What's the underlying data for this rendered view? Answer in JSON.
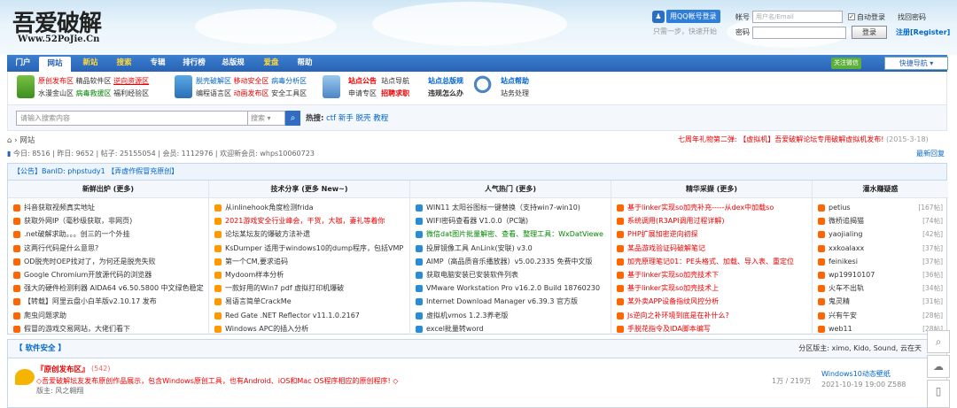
{
  "logo": {
    "title": "吾爱破解",
    "url": "Www.52PoJie.Cn"
  },
  "login": {
    "qq_button": "用QQ帐号登录",
    "qq_tip": "只需一步，快速开始",
    "account_label": "帐号",
    "account_placeholder": "用户名/Email",
    "auto_login": "自动登录",
    "find_password": "找回密码",
    "password_label": "密码",
    "login_button": "登录",
    "register": "注册[Register]"
  },
  "nav": {
    "items": [
      "门户",
      "网站",
      "新站",
      "搜索",
      "专辑",
      "排行榜",
      "总版规",
      "爱盘",
      "帮助"
    ],
    "wechat": "关注微信",
    "quick_nav": "快捷导航"
  },
  "subnav": {
    "g1": {
      "line1": [
        "原创发布区",
        "精品软件区",
        "逆向资源区"
      ],
      "line2": [
        "水漫金山区",
        "病毒救援区",
        "福利经验区"
      ]
    },
    "g2": {
      "line1": [
        "脱壳破解区",
        "移动安全区",
        "病毒分析区"
      ],
      "line2": [
        "编程语言区",
        "动画发布区",
        "安全工具区"
      ]
    },
    "g3": {
      "line1": [
        "站点公告",
        "站点导航"
      ],
      "line2": [
        "申请专区",
        "招聘求职"
      ]
    },
    "g4": {
      "line1": [
        "站点总版规",
        "站点帮助"
      ],
      "line2": [
        "违规怎么办",
        "站务处理"
      ]
    }
  },
  "search": {
    "placeholder": "请输入搜索内容",
    "type": "搜索",
    "hot_label": "热搜:",
    "hot": [
      "ctf",
      "新手",
      "脱壳",
      "教程"
    ]
  },
  "breadcrumb": "网站",
  "promo": {
    "prefix": "七周年礼物第二弹:",
    "link": "【虚拟机】吾爱破解论坛专用破解虚拟机发布!",
    "date": "(2015-3-18)"
  },
  "stats": "今日: 8516 | 昨日: 9652 | 帖子: 25155054 | 会员: 1112976 | 欢迎新会员: whps10060723",
  "latest_reply": "最新回复",
  "announce": "【公告】BanID: phpstudy1 【弄虚作假冒充原创】",
  "columns": [
    {
      "title": "新鲜出炉 (更多)",
      "items": [
        {
          "t": "抖音获取视频真实地址",
          "c": "#f60",
          "tc": "#333"
        },
        {
          "t": "获取外网IP（毫秒级获取，非网页)",
          "c": "#f60",
          "tc": "#333"
        },
        {
          "t": ".net破解求助。。。创三的一个外挂",
          "c": "#f60",
          "tc": "#333"
        },
        {
          "t": "这两行代码是什么意思?",
          "c": "#f60",
          "tc": "#333"
        },
        {
          "t": "OD脱壳时OEP找对了，为何还是脱壳失败",
          "c": "#f60",
          "tc": "#333"
        },
        {
          "t": "Google Chromium开放源代码的浏览器",
          "c": "#f60",
          "tc": "#333"
        },
        {
          "t": "强大的硬件检测利器 AIDA64 v6.50.5800 中文绿色稳定",
          "c": "#f60",
          "tc": "#333"
        },
        {
          "t": "【转载】阿里云盘小白羊版v2.10.17 发布",
          "c": "#f60",
          "tc": "#333"
        },
        {
          "t": "爬虫问题求助",
          "c": "#f60",
          "tc": "#333"
        },
        {
          "t": "假冒的游戏交易网站，大佬们看下",
          "c": "#f60",
          "tc": "#333"
        }
      ]
    },
    {
      "title": "技术分享 (更多 New~)",
      "items": [
        {
          "t": "从inlinehook角度检测frida",
          "c": "#f90",
          "tc": "#333"
        },
        {
          "t": "2021游戏安全行业峰会，干货，大咖，妻礼等着你",
          "c": "#f90",
          "tc": "#e00"
        },
        {
          "t": "论坛某坛友的爆破方法补遗",
          "c": "#f90",
          "tc": "#333"
        },
        {
          "t": "KsDumper 适用于windows10的dump程序，包括VMP",
          "c": "#f90",
          "tc": "#333"
        },
        {
          "t": "第一个CM,要求追码",
          "c": "#f90",
          "tc": "#333"
        },
        {
          "t": "Mydoom样本分析",
          "c": "#f90",
          "tc": "#333"
        },
        {
          "t": "一款好用的Win7 pdf 虚拟打印机爆破",
          "c": "#f90",
          "tc": "#333"
        },
        {
          "t": "易语言简单CrackMe",
          "c": "#f90",
          "tc": "#333"
        },
        {
          "t": "Red Gate .NET Reflector v11.1.0.2167",
          "c": "#f90",
          "tc": "#333"
        },
        {
          "t": "Windows APC的插入分析",
          "c": "#f90",
          "tc": "#333"
        }
      ]
    },
    {
      "title": "人气热门 (更多)",
      "items": [
        {
          "t": "WIN11 太阳谷图标一键替换（支持win7-win10)",
          "c": "#2a8bd8",
          "tc": "#333"
        },
        {
          "t": "WIFI密码查看器 V1.0.0（PC端)",
          "c": "#2a8bd8",
          "tc": "#333"
        },
        {
          "t": "微信dat图片批量解密、查看、整理工具：WxDatViewe",
          "c": "#2a8bd8",
          "tc": "#080"
        },
        {
          "t": "投屏镜像工具 AnLink(安联) v3.0",
          "c": "#2a8bd8",
          "tc": "#333"
        },
        {
          "t": "AIMP（高品质音乐播放器）v5.00.2335 免费中文版",
          "c": "#2a8bd8",
          "tc": "#333"
        },
        {
          "t": "获取电脑安装已安装软件列表",
          "c": "#2a8bd8",
          "tc": "#333"
        },
        {
          "t": "VMware Workstation Pro v16.2.0 Build 18760230",
          "c": "#2a8bd8",
          "tc": "#333"
        },
        {
          "t": "Internet Download Manager v6.39.3 官方版",
          "c": "#2a8bd8",
          "tc": "#333"
        },
        {
          "t": "虚拟机vmos 1.2.3养老版",
          "c": "#2a8bd8",
          "tc": "#333"
        },
        {
          "t": "excel批量转word",
          "c": "#2a8bd8",
          "tc": "#333"
        }
      ]
    },
    {
      "title": "精华采撷 (更多)",
      "items": [
        {
          "t": "基于linker实现so加壳补充-----从dex中加载so",
          "c": "#f60",
          "tc": "#e00"
        },
        {
          "t": "系统调用(R3API调用过程详解)",
          "c": "#f60",
          "tc": "#e00"
        },
        {
          "t": "PHP扩展加密逆向初探",
          "c": "#f60",
          "tc": "#e00"
        },
        {
          "t": "某品游戏验证码破解笔记",
          "c": "#f60",
          "tc": "#e00"
        },
        {
          "t": "加壳原理笔记01：PE头格式、加载、导入表、重定位",
          "c": "#f60",
          "tc": "#e00"
        },
        {
          "t": "基于linker实现so加壳技术下",
          "c": "#f60",
          "tc": "#e00"
        },
        {
          "t": "基于linker实现so加壳技术上",
          "c": "#f60",
          "tc": "#e00"
        },
        {
          "t": "某外卖APP设备指纹风控分析",
          "c": "#f60",
          "tc": "#e00"
        },
        {
          "t": "Js逆向之补环境到底是在补什么?",
          "c": "#f60",
          "tc": "#e00"
        },
        {
          "t": "手脱花指令及IDA脚本编写",
          "c": "#f60",
          "tc": "#e00"
        }
      ]
    },
    {
      "title": "灌水赚疑惑",
      "items": [
        {
          "t": "petius",
          "n": "[167帖]",
          "c": "#f60",
          "tc": "#333"
        },
        {
          "t": "微桥追揭猫",
          "n": "[74帖]",
          "c": "#f60",
          "tc": "#333"
        },
        {
          "t": "yaojialing",
          "n": "[42帖]",
          "c": "#f60",
          "tc": "#333"
        },
        {
          "t": "xxkoalaxx",
          "n": "[37帖]",
          "c": "#f60",
          "tc": "#333"
        },
        {
          "t": "feinikesi",
          "n": "[37帖]",
          "c": "#f60",
          "tc": "#333"
        },
        {
          "t": "wp19910107",
          "n": "[36帖]",
          "c": "#f60",
          "tc": "#333"
        },
        {
          "t": "火车不出轨",
          "n": "[34帖]",
          "c": "#f60",
          "tc": "#333"
        },
        {
          "t": "鬼灵精",
          "n": "[31帖]",
          "c": "#f60",
          "tc": "#333"
        },
        {
          "t": "兴有午安",
          "n": "[28帖]",
          "c": "#f60",
          "tc": "#333"
        },
        {
          "t": "web11",
          "n": "[28帖]",
          "c": "#f60",
          "tc": "#333"
        }
      ]
    }
  ],
  "section": {
    "title": "【 软件安全 】",
    "moderators": "分区版主: ximo, Kido, Sound, 云在天"
  },
  "forum": {
    "name": "『原创发布区』",
    "count": "(542)",
    "desc": "◇吾爱破解坛友发布原创作品展示，包含Windows原创工具，也有Android、iOS和Mac OS程序相应的原创程序! ◇",
    "moderator": "版主: 风之翱翔",
    "threads": "1万 / 219万",
    "last_title": "Windows10动态壁纸",
    "last_time": "2021-10-19 19:00 Z588"
  }
}
